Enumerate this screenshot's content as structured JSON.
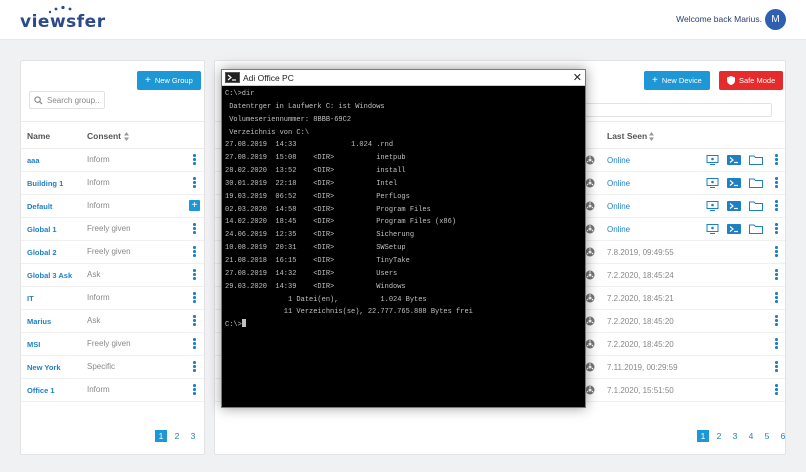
{
  "header": {
    "logo": "viewsfer",
    "welcome": "Welcome back Marius.",
    "avatar_initial": "M"
  },
  "groups": {
    "new_button": "New Group",
    "search_placeholder": "Search group..",
    "columns": {
      "name": "Name",
      "consent": "Consent"
    },
    "rows": [
      {
        "name": "aaa",
        "consent": "Inform"
      },
      {
        "name": "Building 1",
        "consent": "Inform"
      },
      {
        "name": "Default",
        "consent": "Inform"
      },
      {
        "name": "Global 1",
        "consent": "Freely given"
      },
      {
        "name": "Global 2",
        "consent": "Freely given"
      },
      {
        "name": "Global 3 Ask",
        "consent": "Ask"
      },
      {
        "name": "IT",
        "consent": "Inform"
      },
      {
        "name": "Marius",
        "consent": "Ask"
      },
      {
        "name": "MSI",
        "consent": "Freely given"
      },
      {
        "name": "New York",
        "consent": "Specific"
      },
      {
        "name": "Office 1",
        "consent": "Inform"
      }
    ],
    "pages": [
      "1",
      "2",
      "3"
    ]
  },
  "devices": {
    "new_button": "New Device",
    "safe_mode_button": "Safe Mode",
    "columns": {
      "last_seen": "Last Seen"
    },
    "rows": [
      {
        "last_seen": "Online",
        "online": true
      },
      {
        "last_seen": "Online",
        "online": true
      },
      {
        "last_seen": "Online",
        "online": true
      },
      {
        "last_seen": "Online",
        "online": true
      },
      {
        "last_seen": "7.8.2019, 09:49:55",
        "online": false
      },
      {
        "last_seen": "7.2.2020, 18:45:24",
        "online": false
      },
      {
        "last_seen": "7.2.2020, 18:45:21",
        "online": false
      },
      {
        "last_seen": "7.2.2020, 18:45:20",
        "online": false
      },
      {
        "last_seen": "7.2.2020, 18:45:20",
        "online": false
      },
      {
        "last_seen": "7.11.2019, 00:29:59",
        "online": false
      },
      {
        "last_seen": "7.1.2020, 15:51:50",
        "online": false
      }
    ],
    "pages": [
      "1",
      "2",
      "3",
      "4",
      "5",
      "6"
    ]
  },
  "terminal": {
    "title": "Adi Office PC",
    "lines": [
      "",
      "C:\\>dir",
      " Datentrger in Laufwerk C: ist Windows",
      " Volumeseriennummer: 8BBB-69C2",
      "",
      " Verzeichnis von C:\\",
      "",
      "27.08.2019  14:33             1.024 .rnd",
      "27.08.2019  15:08    <DIR>          inetpub",
      "28.02.2020  13:52    <DIR>          install",
      "30.01.2019  22:18    <DIR>          Intel",
      "19.03.2019  06:52    <DIR>          PerfLogs",
      "02.03.2020  14:58    <DIR>          Program Files",
      "14.02.2020  18:45    <DIR>          Program Files (x86)",
      "24.06.2019  12:35    <DIR>          Sicherung",
      "10.08.2019  20:31    <DIR>          SWSetup",
      "21.08.2018  16:15    <DIR>          TinyTake",
      "27.08.2019  14:32    <DIR>          Users",
      "29.03.2020  14:39    <DIR>          Windows",
      "               1 Datei(en),          1.024 Bytes",
      "              11 Verzeichnis(se), 22.777.765.888 Bytes frei",
      "",
      "C:\\>"
    ]
  },
  "colors": {
    "accent": "#1e97d6",
    "danger": "#e52b2b",
    "link": "#1e7fc4"
  }
}
